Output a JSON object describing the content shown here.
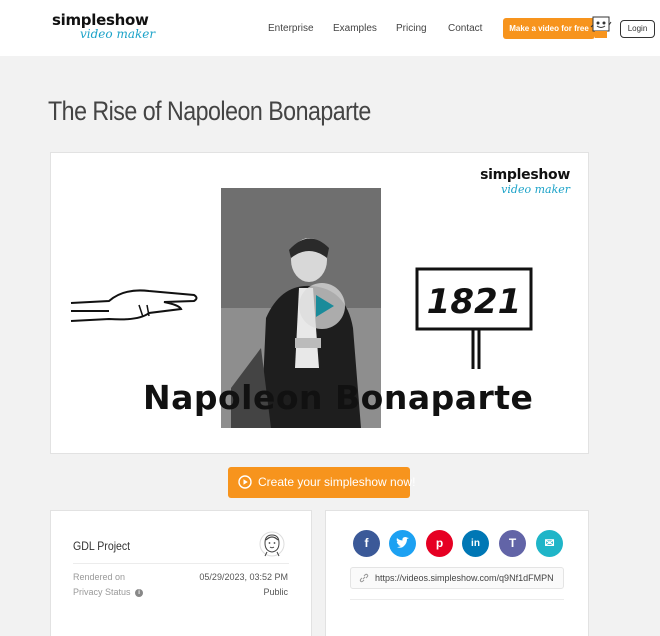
{
  "header": {
    "logo_top": "simpleshow",
    "logo_bottom": "video maker",
    "nav": [
      "Enterprise",
      "Examples",
      "Pricing",
      "Contact"
    ],
    "cta": "Make a video for free",
    "login": "Login"
  },
  "page": {
    "title": "The Rise of Napoleon Bonaparte"
  },
  "video": {
    "logo_top": "simpleshow",
    "logo_bottom": "video maker",
    "caption": "Napoleon Bonaparte",
    "sign_year": "1821"
  },
  "create_button": {
    "label": "Create your simpleshow now!",
    "icon": "play-circle-icon"
  },
  "info": {
    "project": "GDL Project",
    "rendered_label": "Rendered on",
    "rendered_value": "05/29/2023, 03:52 PM",
    "privacy_label": "Privacy Status",
    "privacy_value": "Public"
  },
  "share": {
    "buttons": [
      {
        "name": "facebook-icon",
        "color": "#3b5998",
        "glyph": "f"
      },
      {
        "name": "twitter-icon",
        "color": "#1da1f2",
        "glyph": "t"
      },
      {
        "name": "pinterest-icon",
        "color": "#e60023",
        "glyph": "p"
      },
      {
        "name": "linkedin-icon",
        "color": "#0077b5",
        "glyph": "in"
      },
      {
        "name": "teams-icon",
        "color": "#6264a7",
        "glyph": "T"
      },
      {
        "name": "email-icon",
        "color": "#1fb5c8",
        "glyph": "✉"
      }
    ],
    "url": "https://videos.simpleshow.com/q9Nf1dFMPN"
  },
  "colors": {
    "accent": "#f7941d",
    "brand_blue": "#1aa2c8",
    "play_teal": "#1a8b9a"
  }
}
